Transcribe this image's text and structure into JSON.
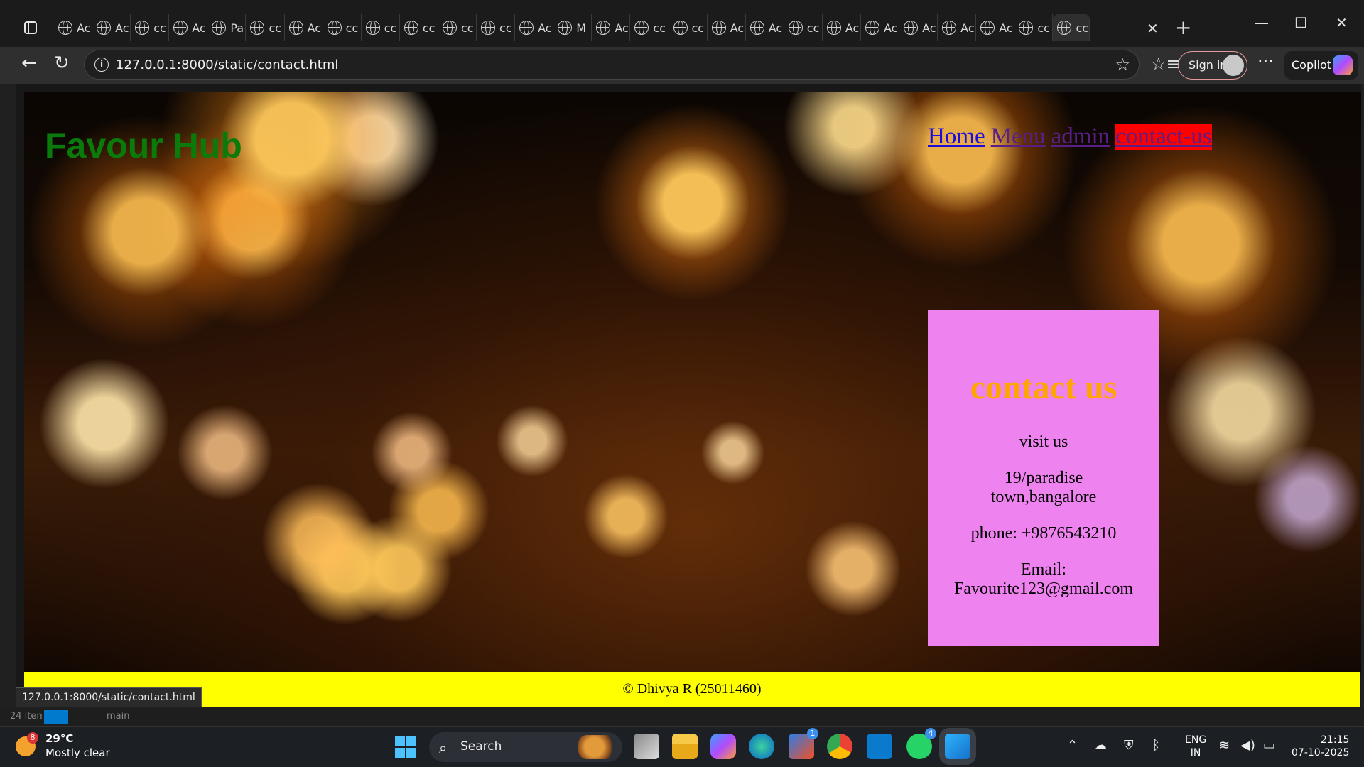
{
  "browser": {
    "tabs": [
      "Ac",
      "Ac",
      "cc",
      "Ac",
      "Pa",
      "cc",
      "Ac",
      "cc",
      "cc",
      "cc",
      "cc",
      "cc",
      "Ac",
      "M",
      "Ac",
      "cc",
      "cc",
      "Ac",
      "Ac",
      "cc",
      "Ac",
      "Ac",
      "Ac",
      "Ac",
      "Ac",
      "cc",
      "cc"
    ],
    "active_tab_index": 26,
    "url": "127.0.0.1:8000/static/contact.html",
    "sign_in_label": "Sign in",
    "copilot_label": "Copilot",
    "status_url": "127.0.0.1:8000/static/contact.html"
  },
  "site": {
    "brand": "Favour Hub",
    "nav": [
      {
        "label": "Home"
      },
      {
        "label": "Menu"
      },
      {
        "label": "admin"
      },
      {
        "label": "contact-us"
      }
    ],
    "contact": {
      "heading": "contact us",
      "visit": "visit us",
      "address_line1": "19/paradise",
      "address_line2": "town,bangalore",
      "phone": "phone: +9876543210",
      "email_label": "Email:",
      "email": "Favourite123@gmail.com"
    },
    "footer": "© Dhivya R (25011460)"
  },
  "behind_window": {
    "items_count": "24 iten",
    "branch": "main"
  },
  "taskbar": {
    "weather_badge": "8",
    "temperature": "29°C",
    "weather": "Mostly clear",
    "search_placeholder": "Search",
    "store_badge": "1",
    "whatsapp_badge": "4",
    "lang_top": "ENG",
    "lang_bottom": "IN",
    "time": "21:15",
    "date": "07-10-2025"
  },
  "colors": {
    "brand_green": "#0a7a0a",
    "card_violet": "#ee82ee",
    "heading_orange": "#ffa500",
    "footer_yellow": "#ffff00",
    "active_nav_red": "#ff0000"
  }
}
